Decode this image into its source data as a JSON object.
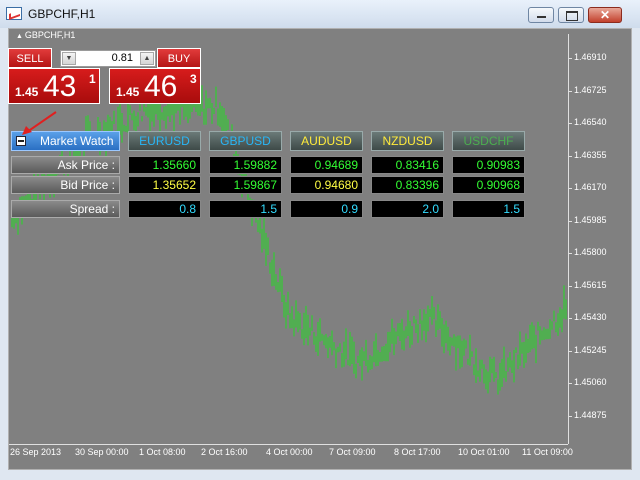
{
  "window": {
    "title": "GBPCHF,H1"
  },
  "chart": {
    "symbol_label": "GBPCHF,H1",
    "y_ticks": [
      "1.46910",
      "1.46725",
      "1.46540",
      "1.46355",
      "1.46170",
      "1.45985",
      "1.45800",
      "1.45615",
      "1.45430",
      "1.45245",
      "1.45060",
      "1.44875"
    ],
    "x_ticks": [
      "26 Sep 2013",
      "30 Sep 00:00",
      "1 Oct 08:00",
      "2 Oct 16:00",
      "4 Oct 00:00",
      "7 Oct 09:00",
      "8 Oct 17:00",
      "10 Oct 01:00",
      "11 Oct 09:00"
    ],
    "colors": {
      "background": "#808080",
      "bars": "#22dd22",
      "axis": "#ffffff"
    }
  },
  "chart_data": {
    "type": "bar",
    "title": "GBPCHF,H1",
    "ylim": [
      1.4475,
      1.47
    ],
    "x": [
      "26 Sep 2013",
      "30 Sep 00:00",
      "1 Oct 08:00",
      "2 Oct 16:00",
      "4 Oct 00:00",
      "7 Oct 09:00",
      "8 Oct 17:00",
      "10 Oct 01:00",
      "11 Oct 09:00"
    ],
    "close_profile": [
      1.46,
      1.464,
      1.466,
      1.466,
      1.4545,
      1.452,
      1.4545,
      1.451,
      1.455
    ]
  },
  "trade_panel": {
    "sell_label": "SELL",
    "buy_label": "BUY",
    "lot_value": "0.81",
    "sell_price": {
      "small": "1.45",
      "big": "43",
      "sup": "1"
    },
    "buy_price": {
      "small": "1.45",
      "big": "46",
      "sup": "3"
    },
    "colors": {
      "button": "#cc1a1a"
    }
  },
  "market_watch": {
    "title": "Market Watch",
    "symbols": [
      "EURUSD",
      "GBPUSD",
      "AUDUSD",
      "NZDUSD",
      "USDCHF"
    ],
    "symbol_colors": [
      "#29b6f6",
      "#29b6f6",
      "#ffeb3b",
      "#ffeb3b",
      "#4caf50"
    ],
    "row_labels": {
      "ask": "Ask Price :",
      "bid": "Bid Price :",
      "spread": "Spread :"
    },
    "ask": [
      "1.35660",
      "1.59882",
      "0.94689",
      "0.83416",
      "0.90983"
    ],
    "ask_colors": [
      "#33ff33",
      "#33ff33",
      "#33ff33",
      "#33ff33",
      "#33ff33"
    ],
    "bid": [
      "1.35652",
      "1.59867",
      "0.94680",
      "0.83396",
      "0.90968"
    ],
    "bid_colors": [
      "#ffff44",
      "#33ff33",
      "#ffff44",
      "#33ff33",
      "#33ff33"
    ],
    "spread": [
      "0.8",
      "1.5",
      "0.9",
      "2.0",
      "1.5"
    ],
    "spread_color": "#33ddff"
  }
}
